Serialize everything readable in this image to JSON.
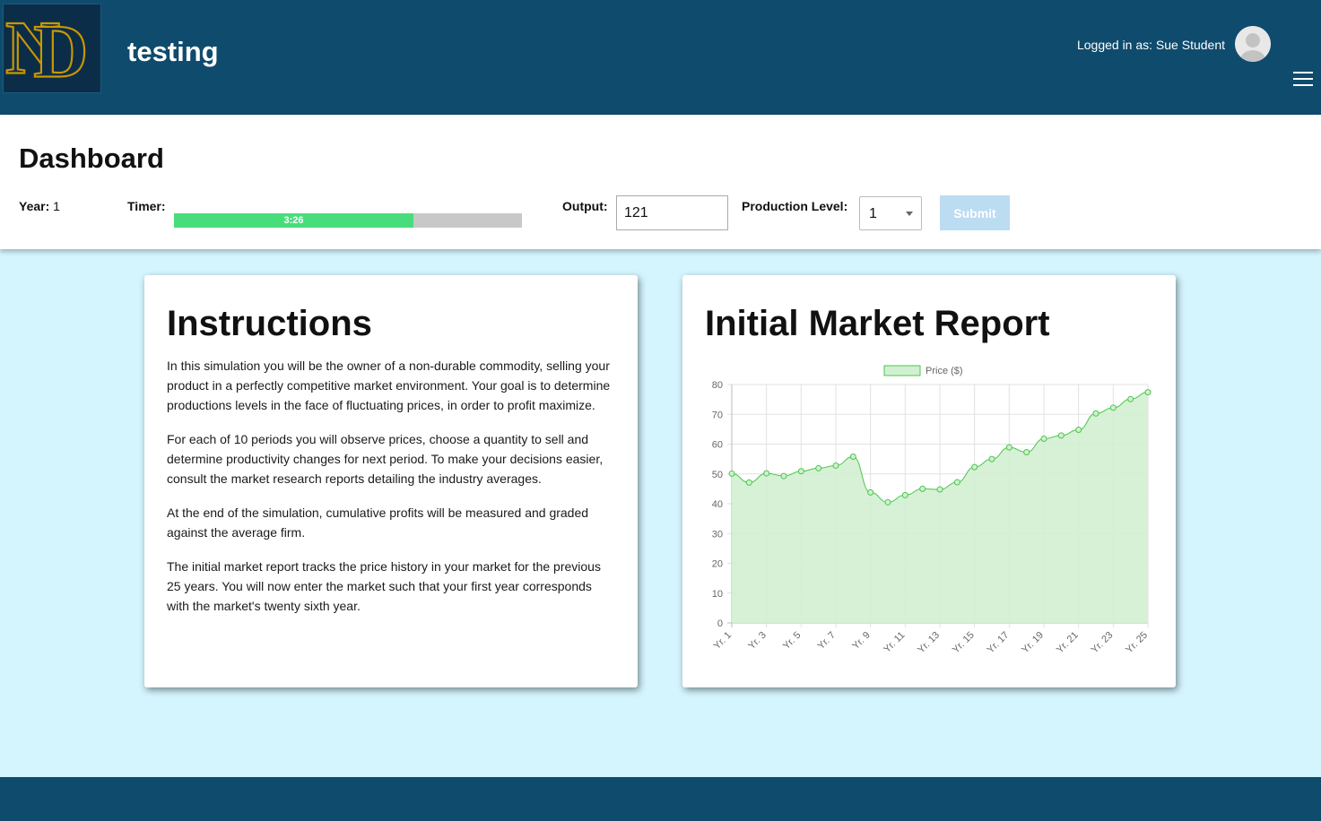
{
  "header": {
    "title": "testing",
    "logged_in_label": "Logged in as: Sue Student"
  },
  "dashboard": {
    "title": "Dashboard",
    "year_label": "Year:",
    "year_value": "1",
    "timer_label": "Timer:",
    "timer_text": "3:26",
    "timer_fraction": 0.688,
    "output_label": "Output:",
    "output_value": "121",
    "production_level_label": "Production Level:",
    "production_level_value": "1",
    "submit_label": "Submit"
  },
  "instructions": {
    "title": "Instructions",
    "paragraphs": [
      "In this simulation you will be the owner of a non-durable commodity, selling your product in a perfectly competitive market environment. Your goal is to determine productions levels in the face of fluctuating prices, in order to profit maximize.",
      "For each of 10 periods you will observe prices, choose a quantity to sell and determine productivity changes for next period. To make your decisions easier, consult the market research reports detailing the industry averages.",
      "At the end of the simulation, cumulative profits will be measured and graded against the average firm.",
      "The initial market report tracks the price history in your market for the previous 25 years. You will now enter the market such that your first year corresponds with the market's twenty sixth year."
    ]
  },
  "market_report": {
    "title": "Initial Market Report"
  },
  "chart_data": {
    "type": "area",
    "categories": [
      "Yr. 1",
      "Yr. 2",
      "Yr. 3",
      "Yr. 4",
      "Yr. 5",
      "Yr. 6",
      "Yr. 7",
      "Yr. 8",
      "Yr. 9",
      "Yr. 10",
      "Yr. 11",
      "Yr. 12",
      "Yr. 13",
      "Yr. 14",
      "Yr. 15",
      "Yr. 16",
      "Yr. 17",
      "Yr. 18",
      "Yr. 19",
      "Yr. 20",
      "Yr. 21",
      "Yr. 22",
      "Yr. 23",
      "Yr. 24",
      "Yr. 25"
    ],
    "tick_labels": [
      "Yr. 1",
      "Yr. 3",
      "Yr. 5",
      "Yr. 7",
      "Yr. 9",
      "Yr. 11",
      "Yr. 13",
      "Yr. 15",
      "Yr. 17",
      "Yr. 19",
      "Yr. 21",
      "Yr. 23",
      "Yr. 25"
    ],
    "series": [
      {
        "name": "Price ($)",
        "values": [
          50.1,
          47.1,
          50.2,
          49.3,
          50.9,
          51.9,
          52.8,
          55.8,
          43.8,
          40.5,
          42.9,
          45.0,
          44.8,
          47.2,
          52.3,
          55.0,
          58.9,
          57.3,
          61.8,
          62.9,
          64.8,
          70.3,
          72.2,
          75.1,
          77.4
        ]
      }
    ],
    "ylim": [
      0,
      80
    ],
    "yticks": [
      0,
      10,
      20,
      30,
      40,
      50,
      60,
      70,
      80
    ],
    "legend_position": "top",
    "grid": true,
    "colors": {
      "line": "#4cc64c",
      "fill": "#d1f0d1"
    }
  }
}
